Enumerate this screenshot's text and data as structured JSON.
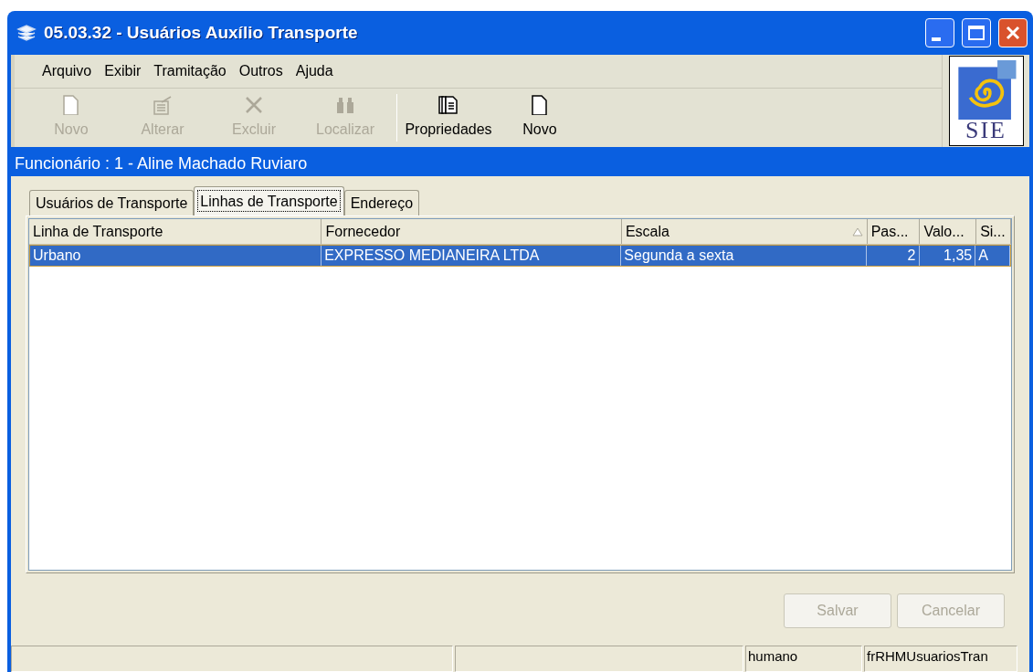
{
  "window": {
    "title": "05.03.32 - Usuários Auxílio Transporte"
  },
  "menu": [
    "Arquivo",
    "Exibir",
    "Tramitação",
    "Outros",
    "Ajuda"
  ],
  "toolbar": [
    {
      "label": "Novo",
      "kind": "new",
      "disabled": true
    },
    {
      "label": "Alterar",
      "kind": "edit",
      "disabled": true
    },
    {
      "label": "Excluir",
      "kind": "delete",
      "disabled": true
    },
    {
      "label": "Localizar",
      "kind": "find",
      "disabled": true
    },
    {
      "label": "Propriedades",
      "kind": "properties",
      "disabled": false,
      "separator": true
    },
    {
      "label": "Novo",
      "kind": "new",
      "disabled": false
    }
  ],
  "logo": {
    "text": "SIE"
  },
  "header": "Funcionário : 1 - Aline Machado Ruviaro",
  "tabs": [
    {
      "label": "Usuários de Transporte",
      "selected": false
    },
    {
      "label": "Linhas de Transporte",
      "selected": true
    },
    {
      "label": "Endereço",
      "selected": false
    }
  ],
  "table": {
    "columns": [
      {
        "label": "Linha de Transporte",
        "sorted": false
      },
      {
        "label": "Fornecedor",
        "sorted": false
      },
      {
        "label": "Escala",
        "sorted": true
      },
      {
        "label": "Pas...",
        "sorted": false
      },
      {
        "label": "Valo...",
        "sorted": false
      },
      {
        "label": "Si...",
        "sorted": false
      }
    ],
    "rows": [
      {
        "cells": [
          "Urbano",
          "EXPRESSO MEDIANEIRA LTDA",
          "Segunda a sexta",
          "2",
          "1,35",
          "A"
        ],
        "selected": true
      }
    ]
  },
  "buttons": [
    {
      "label": "Salvar",
      "disabled": true
    },
    {
      "label": "Cancelar",
      "disabled": true
    }
  ],
  "status_bar": [
    "humano",
    "frRHMUsuariosTran"
  ]
}
